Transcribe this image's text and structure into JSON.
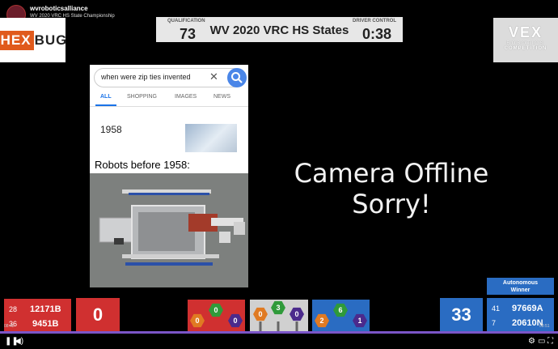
{
  "channel": {
    "name": "wvroboticsalliance",
    "subtitle": "WV 2020 VRC HS State Championship"
  },
  "sponsor": {
    "prefix": "HEX",
    "suffix": "BUG"
  },
  "banner": {
    "qualification_label": "QUALIFICATION",
    "match_number": "73",
    "event_title": "WV 2020 VRC HS States",
    "period_label": "DRIVER CONTROL",
    "timer": "0:38"
  },
  "vex_logo": {
    "main": "VEX",
    "line1": "ROBOTICS",
    "line2": "COMPETITION"
  },
  "search": {
    "query": "when were zip ties invented",
    "tabs": [
      "ALL",
      "SHOPPING",
      "IMAGES",
      "NEWS"
    ],
    "result_year": "1958"
  },
  "caption": "Robots before 1958:",
  "camera_message": {
    "line1": "Camera Offline",
    "line2": "Sorry!"
  },
  "red_alliance": {
    "teams": [
      {
        "rank": "28",
        "team": "12171B"
      },
      {
        "rank": "36",
        "team": "9451B"
      }
    ],
    "score": "0"
  },
  "blue_alliance": {
    "teams": [
      {
        "rank": "41",
        "team": "97669A"
      },
      {
        "rank": "7",
        "team": "20610N"
      }
    ],
    "score": "33"
  },
  "autonomous_badge": {
    "line1": "Autonomous",
    "line2": "Winner"
  },
  "goals": {
    "red": {
      "green": "0",
      "orange": "0",
      "purple": "0"
    },
    "grey": {
      "green": "3",
      "orange": "0",
      "purple": "0"
    },
    "blue": {
      "green": "6",
      "orange": "2",
      "purple": "1"
    }
  },
  "colors": {
    "red": "#d03030",
    "blue": "#2a6cc2",
    "green": "#2f9a3a",
    "orange": "#e07a22",
    "purple": "#4b2a8c",
    "progress": "#7b55c7"
  },
  "player": {
    "progress_percent": 100,
    "time_elapsed": "08:42",
    "time_total": "08:51"
  }
}
